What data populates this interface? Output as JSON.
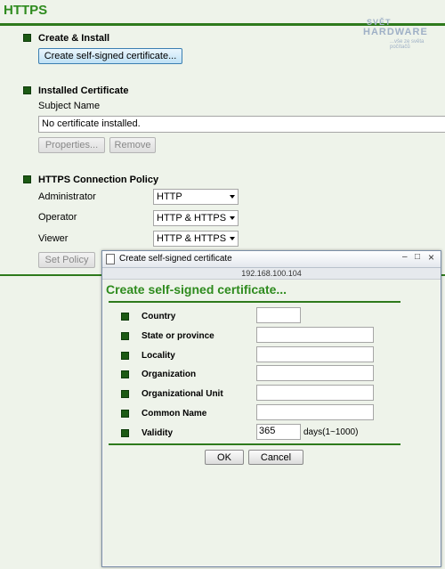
{
  "page": {
    "title": "HTTPS"
  },
  "watermark": {
    "line1": "SVĚT",
    "line2": "HARDWARE",
    "line3": "...vše ze světa počítačů"
  },
  "create_install": {
    "title": "Create & Install",
    "button": "Create self-signed certificate..."
  },
  "installed": {
    "title": "Installed Certificate",
    "subject_label": "Subject Name",
    "subject_value": "No certificate installed.",
    "properties_button": "Properties...",
    "remove_button": "Remove"
  },
  "policy": {
    "title": "HTTPS Connection Policy",
    "rows": [
      {
        "label": "Administrator",
        "value": "HTTP"
      },
      {
        "label": "Operator",
        "value": "HTTP & HTTPS"
      },
      {
        "label": "Viewer",
        "value": "HTTP & HTTPS"
      }
    ],
    "set_button": "Set Policy"
  },
  "dialog": {
    "window_title": "Create self-signed certificate",
    "address": "192.168.100.104",
    "heading": "Create self-signed certificate...",
    "fields": [
      {
        "label": "Country",
        "value": ""
      },
      {
        "label": "State or province",
        "value": ""
      },
      {
        "label": "Locality",
        "value": ""
      },
      {
        "label": "Organization",
        "value": ""
      },
      {
        "label": "Organizational Unit",
        "value": ""
      },
      {
        "label": "Common Name",
        "value": ""
      },
      {
        "label": "Validity",
        "value": "365",
        "suffix": "days(1~1000)"
      }
    ],
    "ok_button": "OK",
    "cancel_button": "Cancel",
    "controls": {
      "minimize": "–",
      "maximize": "□",
      "close": "×"
    }
  },
  "colors": {
    "accent": "#2e8b1e",
    "rule": "#2e7a1c",
    "bullet": "#1c5a14",
    "background": "#eef3ea"
  }
}
